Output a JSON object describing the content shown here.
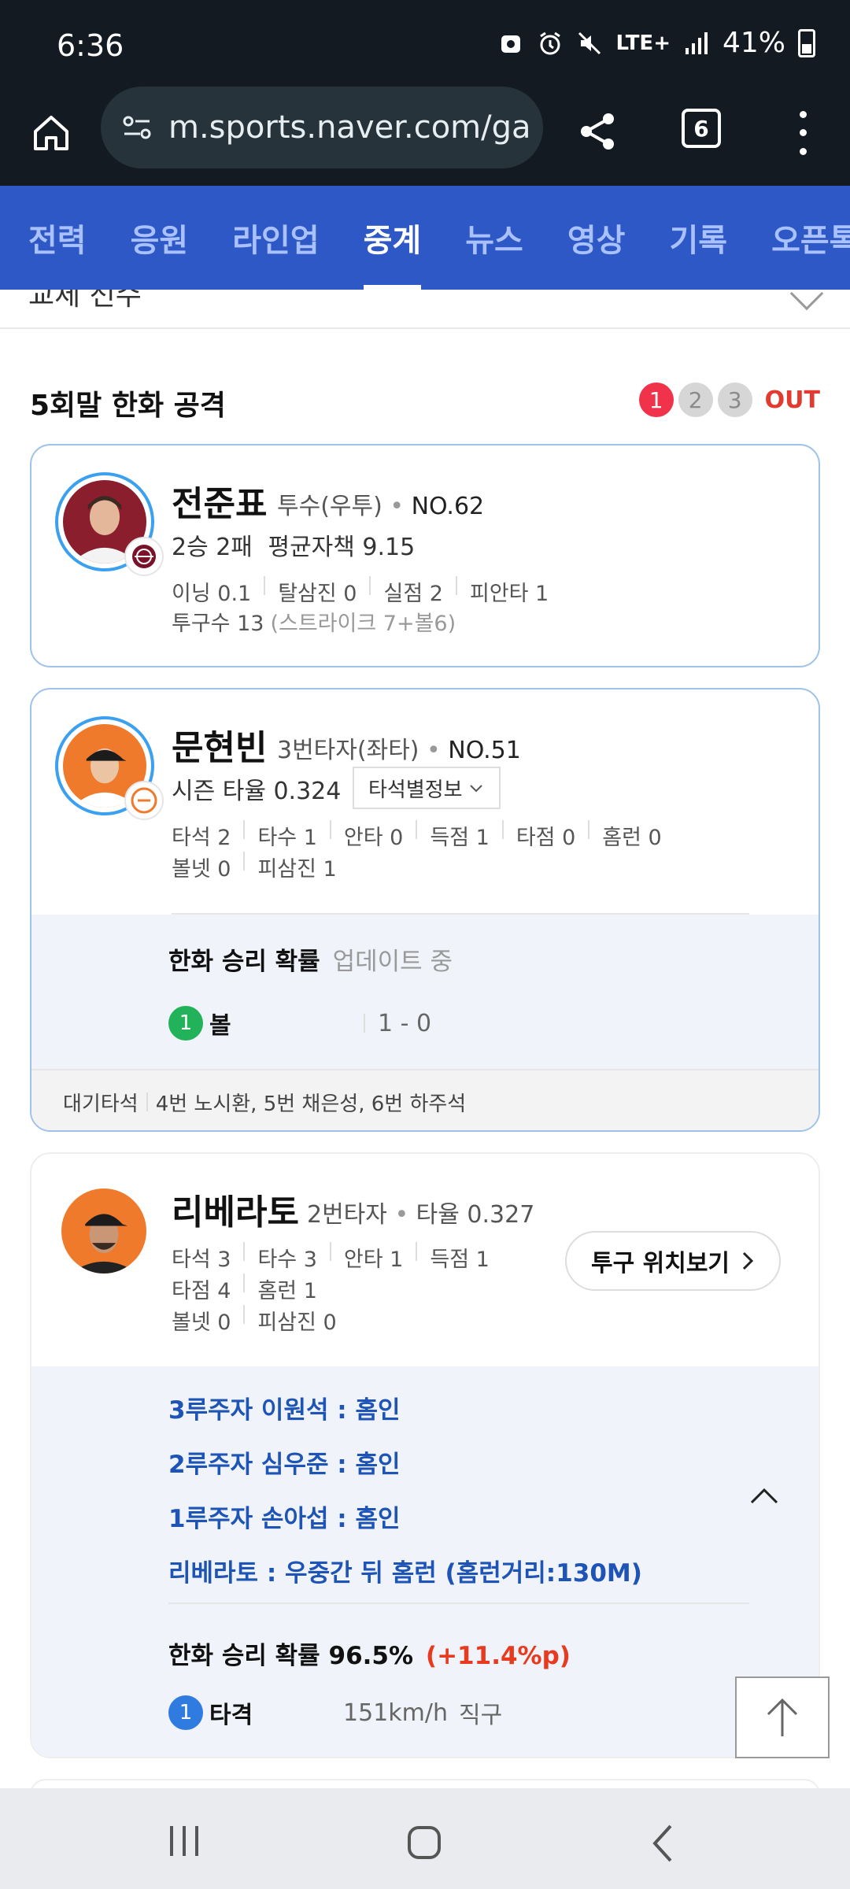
{
  "status": {
    "time": "6:36",
    "network": "LTE+",
    "battery": "41%"
  },
  "browser": {
    "url": "m.sports.naver.com/ga",
    "tab_count": "6"
  },
  "nav": {
    "tabs": [
      {
        "label": "전력"
      },
      {
        "label": "응원"
      },
      {
        "label": "라인업"
      },
      {
        "label": "중계",
        "active": true
      },
      {
        "label": "뉴스"
      },
      {
        "label": "영상"
      },
      {
        "label": "기록"
      },
      {
        "label": "오픈톡"
      }
    ]
  },
  "partial_row": {
    "label": "교체 선수"
  },
  "inning": {
    "title": "5회말 한화 공격",
    "outs": [
      "1",
      "2",
      "3"
    ],
    "out_label": "OUT"
  },
  "pitcher": {
    "name": "전준표",
    "position": "투수(우투)",
    "number": "NO.62",
    "record": "2승 2패",
    "era": "평균자책 9.15",
    "stats": [
      "이닝 0.1",
      "탈삼진 0",
      "실점 2",
      "피안타 1"
    ],
    "pitch_count": "투구수 13",
    "pitch_detail": "(스트라이크 7+볼6)"
  },
  "batter_current": {
    "name": "문현빈",
    "position": "3번타자(좌타)",
    "number": "NO.51",
    "season_avg": "시즌 타율 0.324",
    "dropdown_label": "타석별정보",
    "stats_row1": [
      "타석 2",
      "타수 1",
      "안타 0",
      "득점 1",
      "타점 0",
      "홈런 0"
    ],
    "stats_row2": [
      "볼넷 0",
      "피삼진 1"
    ],
    "win_prob_label": "한화 승리 확률",
    "win_prob_status": "업데이트 중",
    "pitch_no": "1",
    "pitch_type": "볼",
    "count": "1 - 0",
    "on_deck_label": "대기타석",
    "on_deck": "4번 노시환, 5번 채은성, 6번 하주석"
  },
  "batter_prev": {
    "name": "리베라토",
    "position": "2번타자",
    "avg": "타율 0.327",
    "stats_row1": [
      "타석 3",
      "타수 3",
      "안타 1",
      "득점 1"
    ],
    "stats_row2": [
      "타점 4",
      "홈런 1"
    ],
    "stats_row3": [
      "볼넷 0",
      "피삼진 0"
    ],
    "pitch_location_button": "투구 위치보기",
    "events": [
      "3루주자 이원석 : 홈인",
      "2루주자 심우준 : 홈인",
      "1루주자 손아섭 : 홈인",
      "리베라토 : 우중간 뒤 홈런 (홈런거리:130M)"
    ],
    "win_prob_label": "한화 승리 확률 96.5%",
    "win_prob_change": "(+11.4%p)",
    "pitch_no": "1",
    "pitch_result": "타격",
    "speed": "151km/h",
    "pitch_type": "직구"
  },
  "colors": {
    "nav_blue": "#2d58c6",
    "browser_dark": "#131a22",
    "event_blue": "#1d54b5",
    "out_red": "#f0334a",
    "ball_green": "#22b35a",
    "hit_blue": "#2f7be0",
    "prob_change_red": "#e83a1f"
  }
}
